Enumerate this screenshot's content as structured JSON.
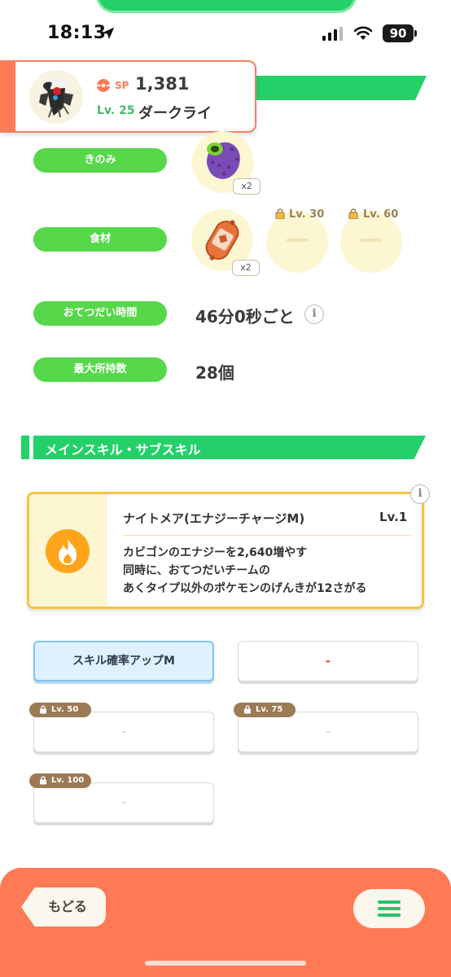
{
  "status_bar": {
    "time": "18:13",
    "battery": "90"
  },
  "pokemon": {
    "sp_label": "SP",
    "sp_value": "1,381",
    "level": "Lv. 25",
    "name": "ダークライ"
  },
  "info_rows": {
    "berry_label": "きのみ",
    "berry_qty": "x2",
    "ingredient_label": "食材",
    "ingredient_qty": "x2",
    "ingredient_lock_1": "Lv. 30",
    "ingredient_lock_2": "Lv. 60",
    "help_time_label": "おてつだい時間",
    "help_time_value": "46分0秒ごと",
    "carry_label": "最大所持数",
    "carry_value": "28個"
  },
  "section": {
    "title": "メインスキル・サブスキル"
  },
  "main_skill": {
    "name": "ナイトメア(エナジーチャージM)",
    "level": "Lv.1",
    "desc_line1": "カビゴンのエナジーを2,640増やす",
    "desc_line2": "同時に、おてつだいチームの",
    "desc_line3": "あくタイプ以外のポケモンのげんきが12さがる"
  },
  "sub_skills": {
    "slot1": "スキル確率アップM",
    "slot2": "-",
    "slot3": "-",
    "slot3_lock": "Lv. 50",
    "slot4": "-",
    "slot4_lock": "Lv. 75",
    "slot5": "-",
    "slot5_lock": "Lv. 100"
  },
  "bottom": {
    "back_label": "もどる"
  },
  "colors": {
    "accent_green": "#23d06a",
    "pill_green": "#56d84a",
    "orange": "#ff7a55",
    "skill_border": "#f4c545"
  }
}
